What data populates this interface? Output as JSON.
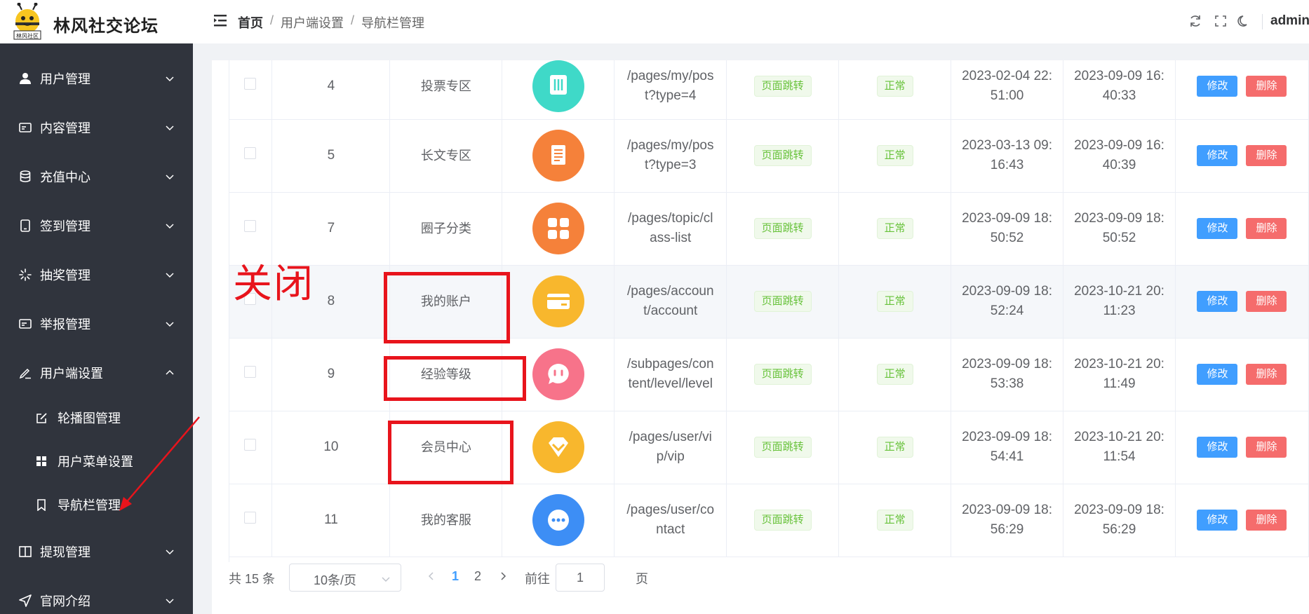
{
  "app": {
    "title": "林风社交论坛",
    "logo_text": "林风社区"
  },
  "header": {
    "breadcrumb": [
      "首页",
      "用户端设置",
      "导航栏管理"
    ],
    "separator": "/",
    "user": "admin"
  },
  "sidebar": {
    "items": [
      {
        "label": "用户管理",
        "icon": "user-icon",
        "expanded": false
      },
      {
        "label": "内容管理",
        "icon": "card-icon",
        "expanded": false
      },
      {
        "label": "充值中心",
        "icon": "database-icon",
        "expanded": false
      },
      {
        "label": "签到管理",
        "icon": "phone-icon",
        "expanded": false
      },
      {
        "label": "抽奖管理",
        "icon": "loading-icon",
        "expanded": false
      },
      {
        "label": "举报管理",
        "icon": "id-card-icon",
        "expanded": false
      },
      {
        "label": "用户端设置",
        "icon": "edit-pen-icon",
        "expanded": true
      },
      {
        "label": "提现管理",
        "icon": "book-icon",
        "expanded": false
      },
      {
        "label": "官网介绍",
        "icon": "send-icon",
        "expanded": false
      }
    ],
    "sub_items": [
      {
        "label": "轮播图管理",
        "icon": "edit-icon"
      },
      {
        "label": "用户菜单设置",
        "icon": "grid-icon"
      },
      {
        "label": "导航栏管理",
        "icon": "bookmark-icon",
        "active": true
      }
    ]
  },
  "table": {
    "rows": [
      {
        "id": "4",
        "name": "投票专区",
        "icon": "vote-icon",
        "color": "#3fd9c8",
        "path": "/pages/my/post?type=4",
        "path_lines": [
          "/pages/my/pos",
          "t?type=4"
        ],
        "type_tag": "页面跳转",
        "status": "正常",
        "created": [
          "2023-02-04 22:",
          "51:00"
        ],
        "updated": [
          "2023-09-09 16:",
          "40:33"
        ]
      },
      {
        "id": "5",
        "name": "长文专区",
        "icon": "document-icon",
        "color": "#f5813a",
        "path": "/pages/my/post?type=3",
        "path_lines": [
          "/pages/my/pos",
          "t?type=3"
        ],
        "type_tag": "页面跳转",
        "status": "正常",
        "created": [
          "2023-03-13 09:",
          "16:43"
        ],
        "updated": [
          "2023-09-09 16:",
          "40:39"
        ]
      },
      {
        "id": "7",
        "name": "圈子分类",
        "icon": "apps-icon",
        "color": "#f5813a",
        "path": "/pages/topic/class-list",
        "path_lines": [
          "/pages/topic/cl",
          "ass-list"
        ],
        "type_tag": "页面跳转",
        "status": "正常",
        "created": [
          "2023-09-09 18:",
          "50:52"
        ],
        "updated": [
          "2023-09-09 18:",
          "50:52"
        ]
      },
      {
        "id": "8",
        "name": "我的账户",
        "icon": "wallet-icon",
        "color": "#f8b72d",
        "path": "/pages/account/account",
        "path_lines": [
          "/pages/accoun",
          "t/account"
        ],
        "type_tag": "页面跳转",
        "status": "正常",
        "created": [
          "2023-09-09 18:",
          "52:24"
        ],
        "updated": [
          "2023-10-21 20:",
          "11:23"
        ]
      },
      {
        "id": "9",
        "name": "经验等级",
        "icon": "chat-bubble-icon",
        "color": "#f7738a",
        "path": "/subpages/content/level/level",
        "path_lines": [
          "/subpages/con",
          "tent/level/level"
        ],
        "type_tag": "页面跳转",
        "status": "正常",
        "created": [
          "2023-09-09 18:",
          "53:38"
        ],
        "updated": [
          "2023-10-21 20:",
          "11:49"
        ]
      },
      {
        "id": "10",
        "name": "会员中心",
        "icon": "diamond-icon",
        "color": "#f8b72d",
        "path": "/pages/user/vip",
        "path_lines": [
          "/pages/user/vi",
          "p/vip"
        ],
        "type_tag": "页面跳转",
        "status": "正常",
        "created": [
          "2023-09-09 18:",
          "54:41"
        ],
        "updated": [
          "2023-10-21 20:",
          "11:54"
        ]
      },
      {
        "id": "11",
        "name": "我的客服",
        "icon": "message-dots-icon",
        "color": "#3d8ef5",
        "path": "/pages/user/contact",
        "path_lines": [
          "/pages/user/co",
          "ntact"
        ],
        "type_tag": "页面跳转",
        "status": "正常",
        "created": [
          "2023-09-09 18:",
          "56:29"
        ],
        "updated": [
          "2023-09-09 18:",
          "56:29"
        ]
      }
    ],
    "edit_label": "修改",
    "delete_label": "删除"
  },
  "pagination": {
    "total": "共 15 条",
    "page_size": "10条/页",
    "pages": [
      "1",
      "2"
    ],
    "current": "1",
    "goto_label": "前往",
    "goto_value": "1",
    "page_suffix": "页"
  },
  "annotation": {
    "text": "关闭",
    "color": "#e8141c"
  },
  "colors": {
    "sidebar_bg": "#30343d",
    "primary": "#409eff",
    "danger": "#f56c6c",
    "success": "#67c23a"
  }
}
